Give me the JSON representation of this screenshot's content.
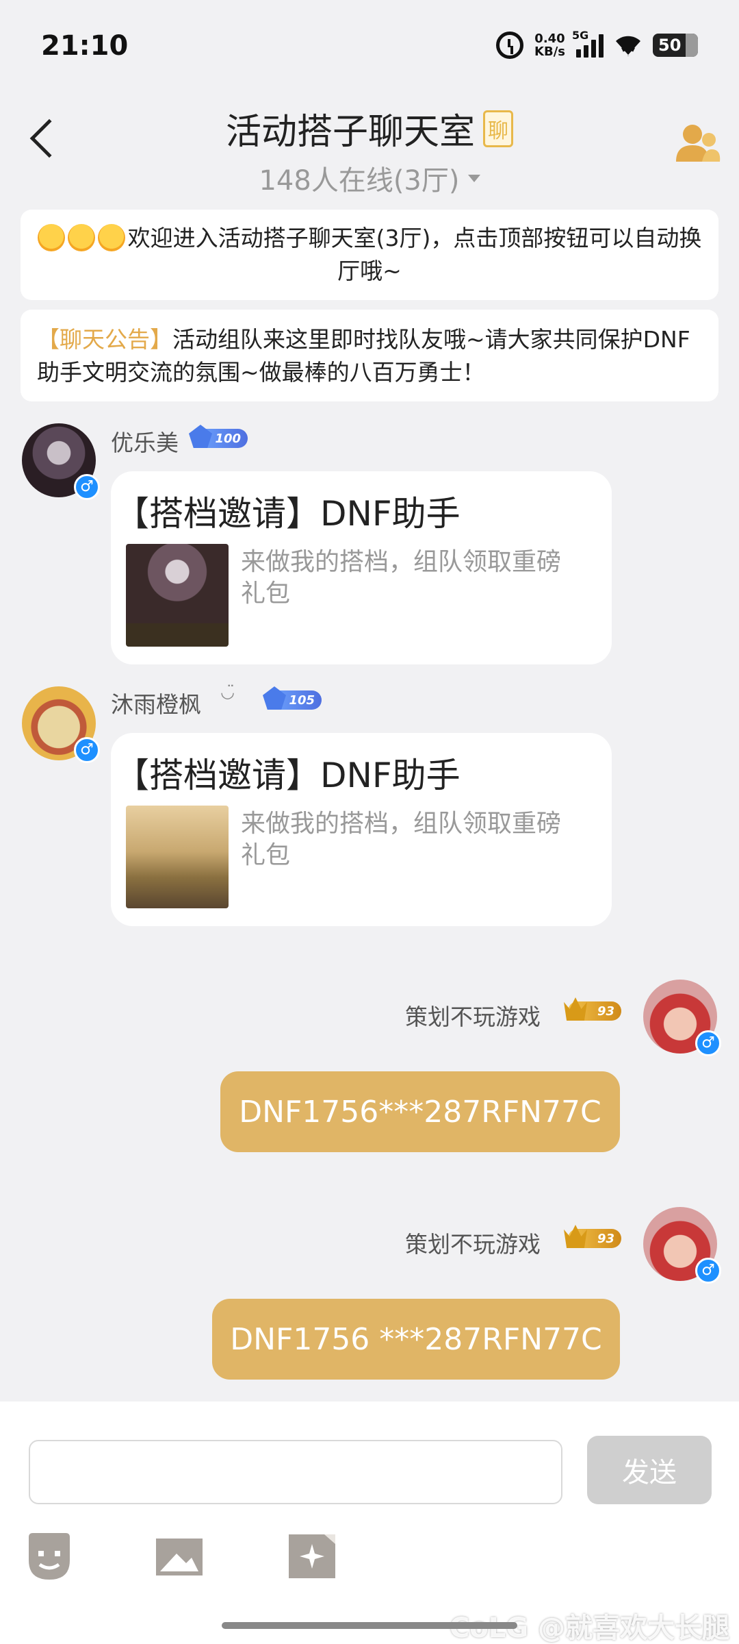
{
  "status_bar": {
    "time": "21:10",
    "net_speed_value": "0.40",
    "net_speed_unit": "KB/s",
    "signal_label": "5G",
    "battery": "50"
  },
  "header": {
    "title": "活动搭子聊天室",
    "title_badge": "聊",
    "subtitle": "148人在线(3厅)"
  },
  "notices": {
    "welcome_text": "欢迎进入活动搭子聊天室(3厅)，点击顶部按钮可以自动换厅哦~",
    "announce_tag": "【聊天公告】",
    "announce_text": "活动组队来这里即时找队友哦~请大家共同保护DNF助手文明交流的氛围~做最棒的八百万勇士！"
  },
  "messages": [
    {
      "username": "优乐美",
      "level": "100",
      "gender": "♂",
      "card_title": "【搭档邀请】DNF助手",
      "card_desc": "来做我的搭档，组队领取重磅礼包"
    },
    {
      "username": "沐雨橙枫",
      "username_suffix": "◡̈",
      "level": "105",
      "gender": "♂",
      "card_title": "【搭档邀请】DNF助手",
      "card_desc": "来做我的搭档，组队领取重磅礼包"
    },
    {
      "username": "策划不玩游戏",
      "level": "93",
      "gender": "♂",
      "text": "DNF1756***287RFN77C"
    },
    {
      "username": "策划不玩游戏",
      "level": "93",
      "gender": "♂",
      "text": "DNF1756 ***287RFN77C"
    }
  ],
  "composer": {
    "input_value": "",
    "send_label": "发送"
  },
  "watermark": "CoLG @就喜欢大长腿",
  "colors": {
    "accent_gold": "#e0b566",
    "level_blue": "#4f6fe0",
    "gender_blue": "#1e90ff",
    "announce_tag": "#e3a94a"
  }
}
